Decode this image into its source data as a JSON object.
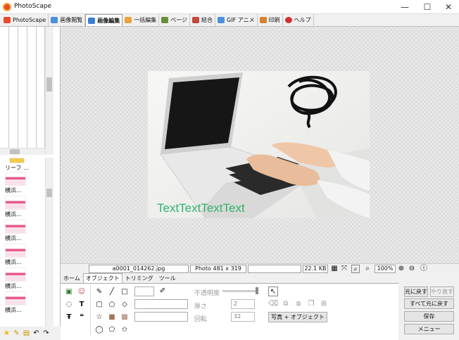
{
  "window": {
    "title": "PhotoScape",
    "minimize": "—",
    "maximize": "☐",
    "close": "✕"
  },
  "tabs": [
    {
      "label": "PhotoScape",
      "icon": "photoscape-icon",
      "color": "#e8492f"
    },
    {
      "label": "画像閲覧",
      "icon": "viewer-icon",
      "color": "#4a90d9"
    },
    {
      "label": "画像編集",
      "icon": "editor-icon",
      "color": "#3b7fd1"
    },
    {
      "label": "一括編集",
      "icon": "batch-icon",
      "color": "#e8a33a"
    },
    {
      "label": "ページ",
      "icon": "page-icon",
      "color": "#6b8e3c"
    },
    {
      "label": "結合",
      "icon": "combine-icon",
      "color": "#c2473d"
    },
    {
      "label": "GIF アニメ",
      "icon": "gif-icon",
      "color": "#4a90d9"
    },
    {
      "label": "印刷",
      "icon": "print-icon",
      "color": "#d9822b"
    },
    {
      "label": "ヘルプ",
      "icon": "help-icon",
      "color": "#d32f2f"
    }
  ],
  "active_tab": "画像編集",
  "thumbnails": [
    {
      "label": "リーフ ..."
    },
    {
      "label": "横浜..."
    },
    {
      "label": "横浜..."
    },
    {
      "label": "横浜..."
    },
    {
      "label": "横浜..."
    },
    {
      "label": "横浜..."
    },
    {
      "label": "横浜..."
    }
  ],
  "photo": {
    "overlay_text": "TextTextTextText",
    "overlay_color": "#2eb36b"
  },
  "status": {
    "filename": "a0001_014262.jpg",
    "info": "Photo 481 x 319",
    "filesize": "22.1 KB",
    "zoom": "100%"
  },
  "edit_tabs": [
    "ホーム",
    "オブジェクト",
    "トリミング",
    "ツール"
  ],
  "active_edit_tab": "オブジェクト",
  "object_panel": {
    "opacity_label": "不透明度",
    "thickness_label": "厚さ",
    "thickness_value": "2",
    "rotation_label": "回転",
    "rotation_value": "32",
    "photo_object_button": "写真 + オブジェクト"
  },
  "right_buttons": {
    "undo": "元に戻す",
    "redo": "やり直す",
    "undo_all": "すべて元に戻す",
    "save": "保存",
    "menu": "メニュー"
  }
}
